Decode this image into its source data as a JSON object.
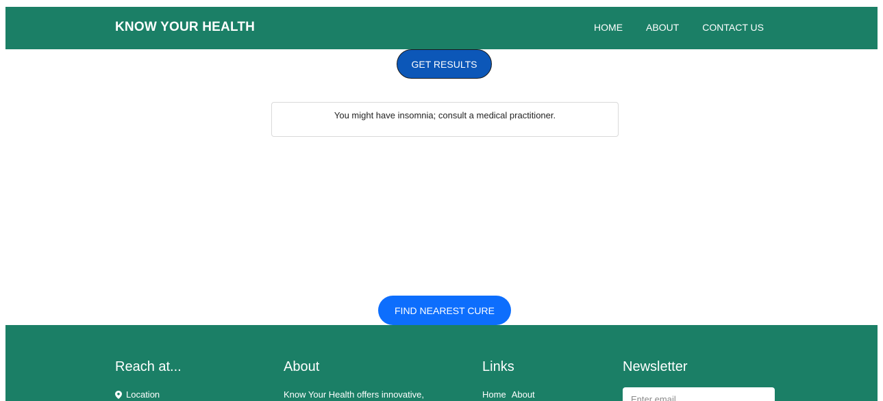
{
  "nav": {
    "brand": "KNOW YOUR HEALTH",
    "links": [
      "HOME",
      "ABOUT",
      "CONTACT US"
    ]
  },
  "main": {
    "get_results_label": "GET RESULTS",
    "result_message": "You might have insomnia; consult a medical practitioner.",
    "find_cure_label": "FIND NEAREST CURE"
  },
  "footer": {
    "reach": {
      "heading": "Reach at...",
      "location_label": "Location",
      "location_icon": "map-pin-icon"
    },
    "about": {
      "heading": "About",
      "text": "Know Your Health offers innovative,"
    },
    "links": {
      "heading": "Links",
      "items": [
        "Home",
        "About"
      ]
    },
    "newsletter": {
      "heading": "Newsletter",
      "email_placeholder": "Enter email"
    }
  },
  "colors": {
    "brand_green": "#1b7f66",
    "get_results_blue": "#0c57b8",
    "find_cure_blue": "#0d6efd"
  }
}
